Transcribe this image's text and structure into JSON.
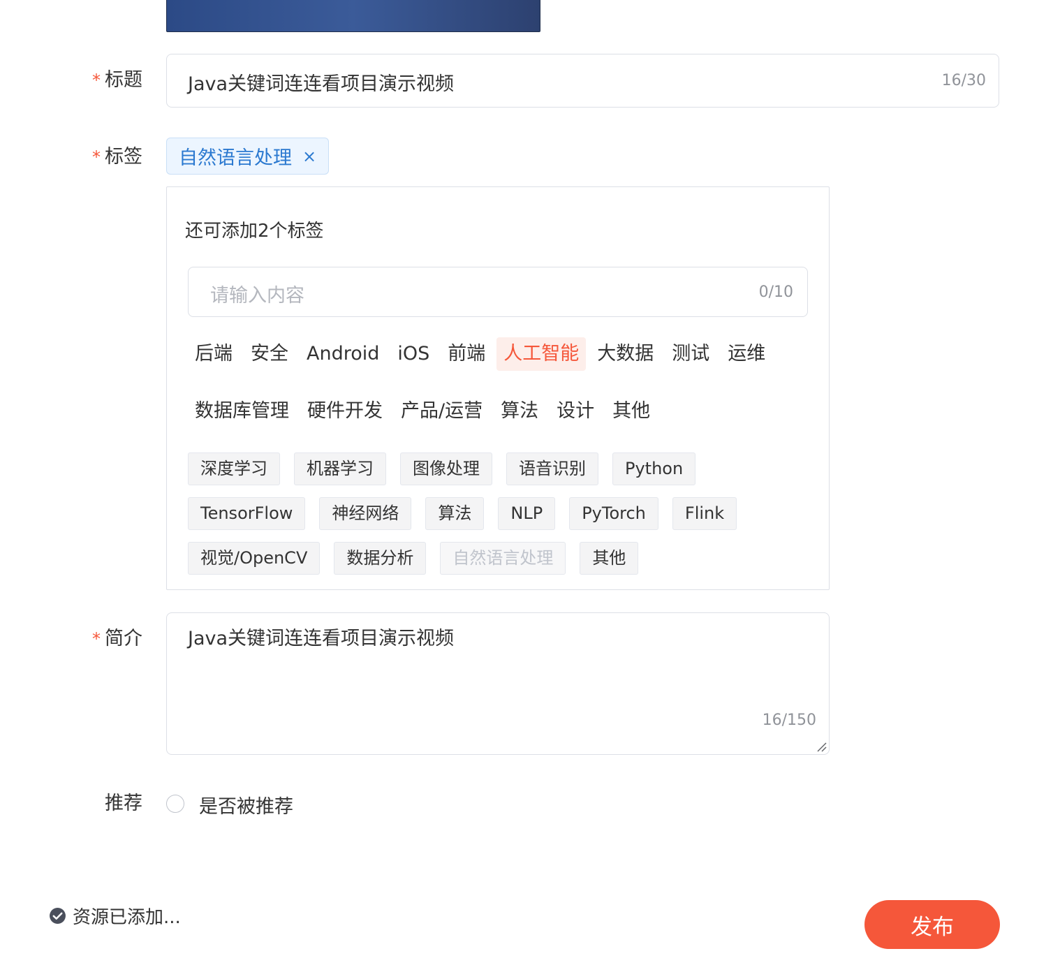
{
  "form": {
    "title_label": "标题",
    "title_value": "Java关键词连连看项目演示视频",
    "title_counter": "16/30",
    "tags_label": "标签",
    "selected_tag": "自然语言处理",
    "selected_tag_remove": "×",
    "tag_hint": "还可添加2个标签",
    "tag_input_placeholder": "请输入内容",
    "tag_input_counter": "0/10",
    "categories_row1": [
      "后端",
      "安全",
      "Android",
      "iOS",
      "前端",
      "人工智能",
      "大数据",
      "测试",
      "运维"
    ],
    "categories_row2": [
      "数据库管理",
      "硬件开发",
      "产品/运营",
      "算法",
      "设计",
      "其他"
    ],
    "active_category": "人工智能",
    "subtags": [
      "深度学习",
      "机器学习",
      "图像处理",
      "语音识别",
      "Python",
      "TensorFlow",
      "神经网络",
      "算法",
      "NLP",
      "PyTorch",
      "Flink",
      "视觉/OpenCV",
      "数据分析",
      "自然语言处理",
      "其他"
    ],
    "disabled_subtag": "自然语言处理",
    "desc_label": "简介",
    "desc_value": "Java关键词连连看项目演示视频",
    "desc_counter": "16/150",
    "recommend_label": "推荐",
    "recommend_option": "是否被推荐",
    "recommend_checked": false,
    "required_mark": "*"
  },
  "footer": {
    "status_text": "资源已添加...",
    "publish_label": "发布"
  },
  "colors": {
    "accent": "#f5573a",
    "tag_blue": "#2b79d0",
    "border": "#dcdfe6"
  },
  "icons": {
    "status": "check-circle-icon",
    "remove": "close-icon"
  }
}
